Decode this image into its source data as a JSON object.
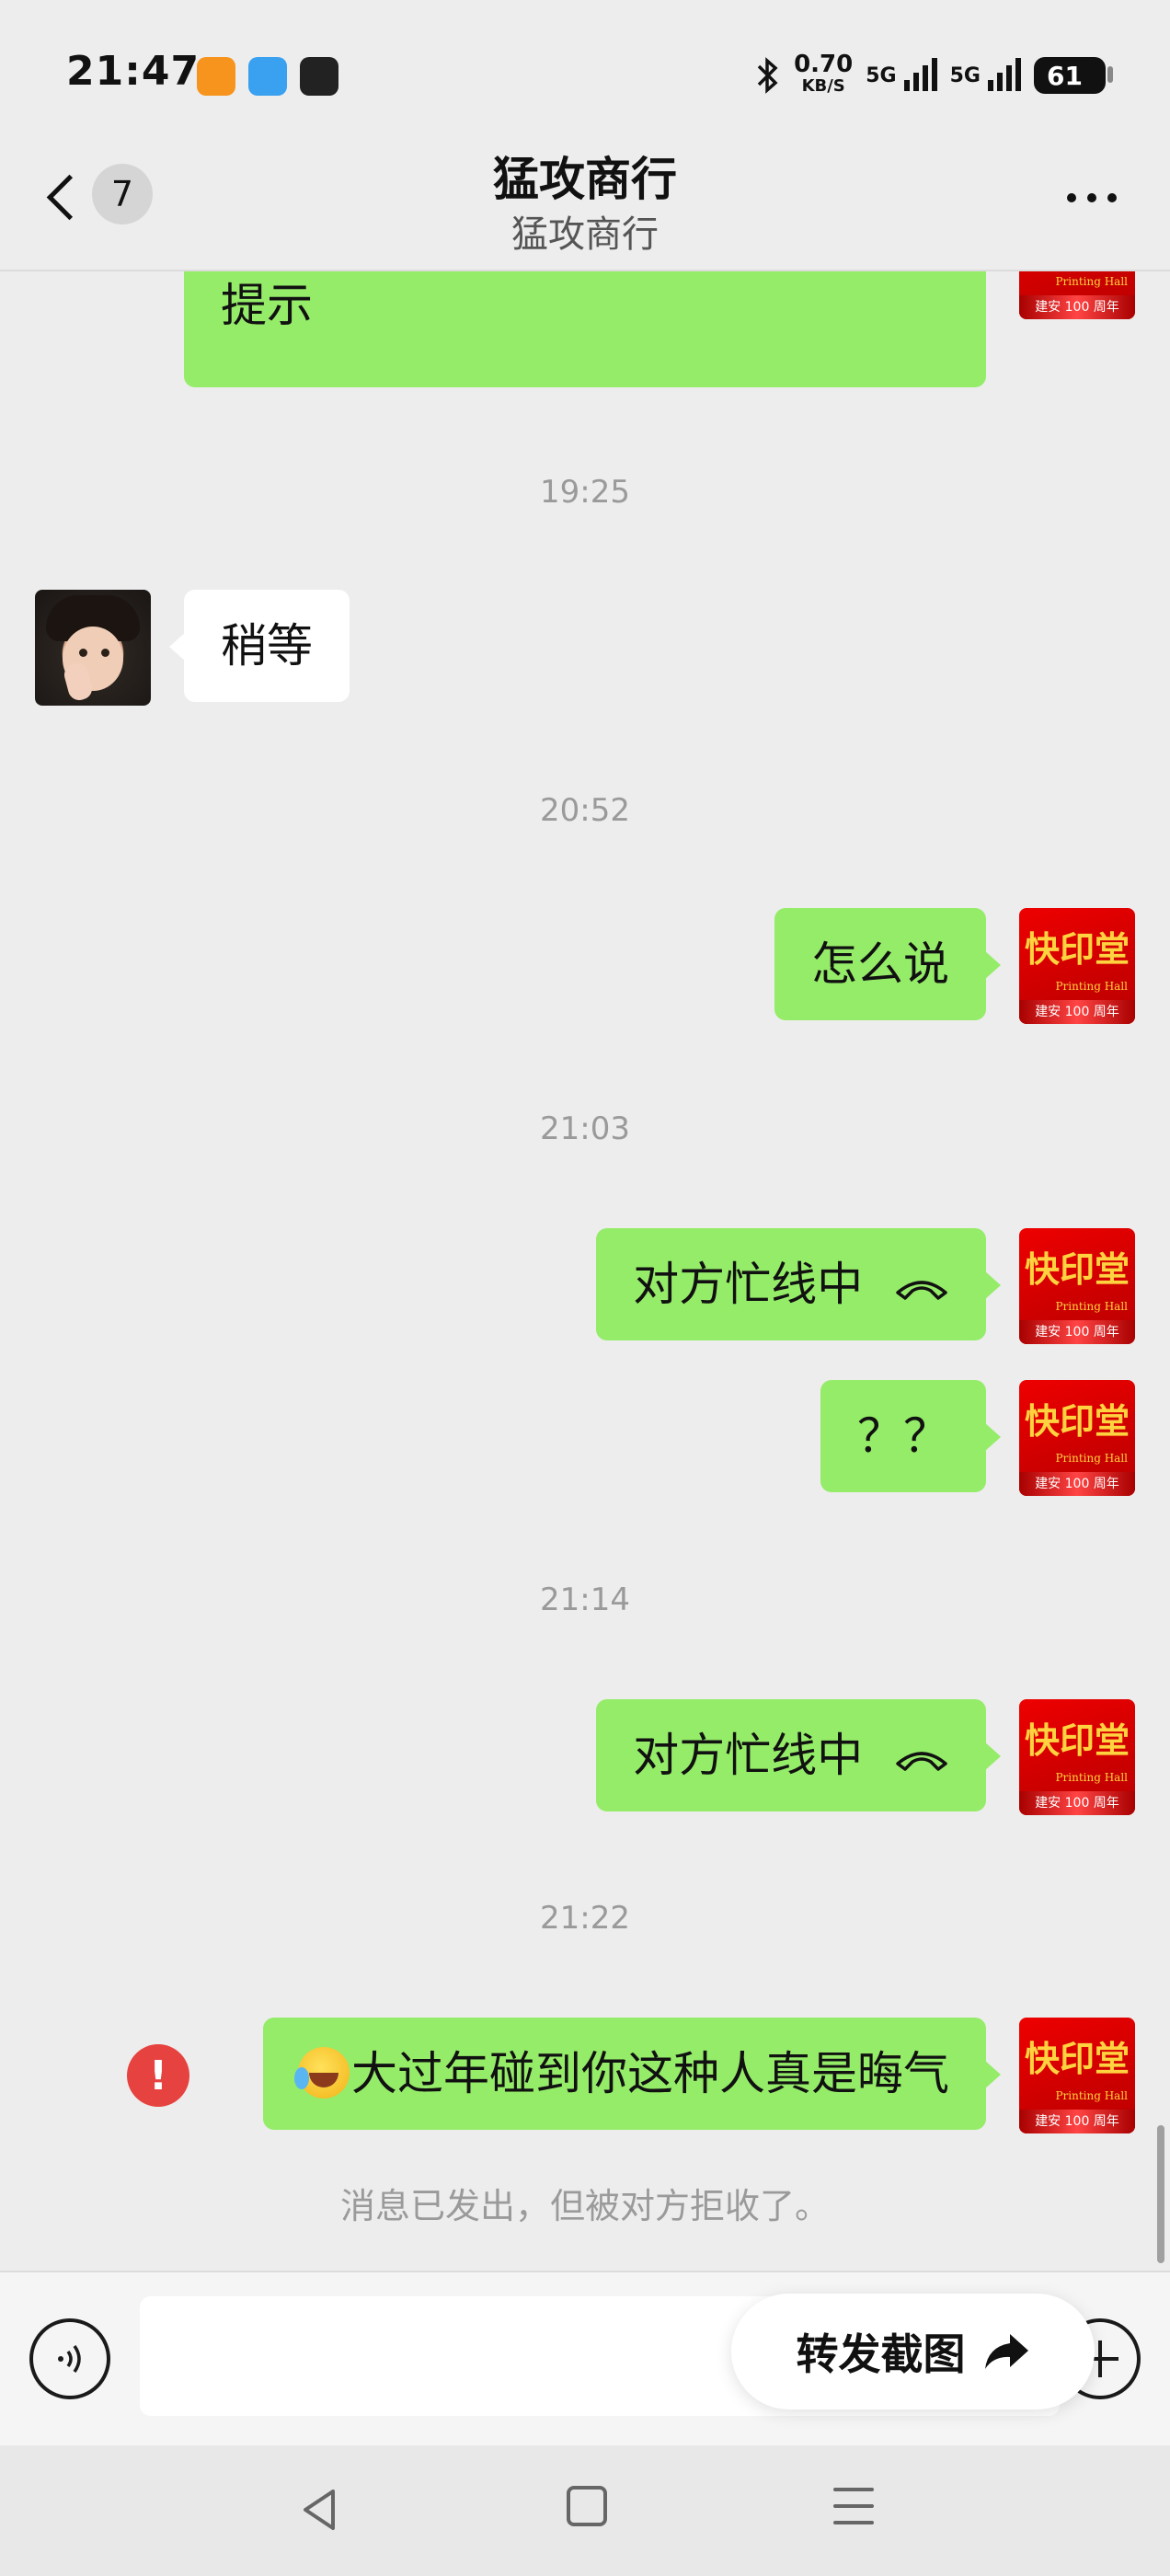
{
  "status_bar": {
    "time": "21:47",
    "net_speed": "0.70",
    "net_unit": "KB/S",
    "sim1": "5G",
    "sim2": "5G",
    "battery": "61",
    "app_icons": [
      "flash-app-icon",
      "weather-app-icon",
      "shield-app-icon"
    ]
  },
  "header": {
    "unread_count": "7",
    "title": "猛攻商行",
    "subtitle": "猛攻商行"
  },
  "messages": [
    {
      "from": "me",
      "text": "要我这边自己打一阵，才不出这个提示",
      "text_visible_line": "提示"
    },
    {
      "timestamp": "19:25"
    },
    {
      "from": "other",
      "text": "稍等"
    },
    {
      "timestamp": "20:52"
    },
    {
      "from": "me",
      "text": "怎么说"
    },
    {
      "timestamp": "21:03"
    },
    {
      "from": "me",
      "text": "对方忙线中"
    },
    {
      "from": "me",
      "text": "？？"
    },
    {
      "timestamp": "21:14"
    },
    {
      "from": "me",
      "text": "对方忙线中"
    },
    {
      "timestamp": "21:22"
    },
    {
      "from": "me",
      "text": "大过年碰到你这种人真是晦气",
      "failed": true
    }
  ],
  "system_notice": "消息已发出，但被对方拒收了。",
  "my_avatar": {
    "logo_text": "快印堂",
    "sub_text": "Printing Hall",
    "bottom_text": "建安 100 周年"
  },
  "error_mark": "!",
  "forward_button": {
    "label": "转发截图"
  },
  "colors": {
    "my_bubble": "#95ec69",
    "other_bubble": "#ffffff",
    "error": "#e64340"
  }
}
